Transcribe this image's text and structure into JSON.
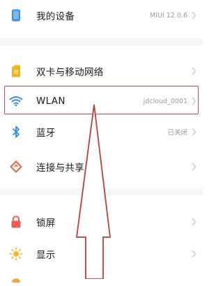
{
  "settings": {
    "items": [
      {
        "label": "我的设备",
        "value": "MIUI 12.0.6",
        "icon": "phone-icon",
        "color": "#3d8ce6"
      },
      {
        "label": "双卡与移动网络",
        "value": "",
        "icon": "sim-card-icon",
        "color": "#f2b320"
      },
      {
        "label": "WLAN",
        "value": "jdcloud_0001",
        "icon": "wifi-icon",
        "color": "#2d8ee8"
      },
      {
        "label": "蓝牙",
        "value": "已关闭",
        "icon": "bluetooth-icon",
        "color": "#2d8ee8"
      },
      {
        "label": "连接与共享",
        "value": "",
        "icon": "connection-share-icon",
        "color": "#e86a52"
      },
      {
        "label": "锁屏",
        "value": "",
        "icon": "lock-icon",
        "color": "#ef5a5a"
      },
      {
        "label": "显示",
        "value": "",
        "icon": "brightness-icon",
        "color": "#f5b82a"
      }
    ]
  },
  "annotation": {
    "highlight_color": "#d24848",
    "arrow_fill": "#ffffff",
    "arrow_stroke": "#c23a3a"
  }
}
